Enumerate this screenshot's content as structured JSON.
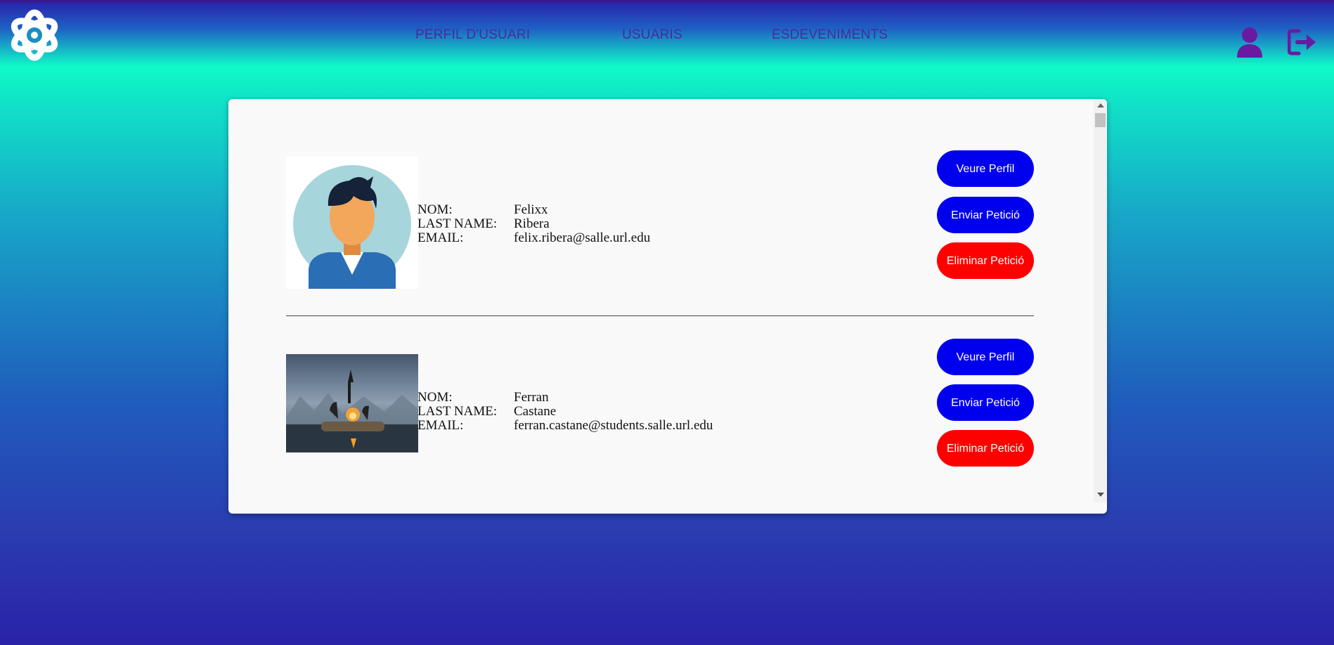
{
  "nav": {
    "profile": "PERFIL D'USUARI",
    "users": "USUARIS",
    "events": "ESDEVENIMENTS"
  },
  "icons": {
    "logo": "atom-gear-logo",
    "user": "user-icon",
    "logout": "logout-icon"
  },
  "colors": {
    "nav_text": "#4b2a9a",
    "primary_button": "#0000ee",
    "danger_button": "#ff0000"
  },
  "labels": {
    "name": "NOM:",
    "last_name": "LAST NAME:",
    "email": "EMAIL:"
  },
  "users": [
    {
      "name": "Felixx",
      "last_name": "Ribera",
      "email": "felix.ribera@salle.url.edu",
      "buttons": {
        "view": "Veure Perfil",
        "send": "Enviar Petició",
        "delete": "Eliminar Petició"
      }
    },
    {
      "name": "Ferran",
      "last_name": "Castane",
      "email": "ferran.castane@students.salle.url.edu",
      "buttons": {
        "view": "Veure Perfil",
        "send": "Enviar Petició",
        "delete": "Eliminar Petició"
      }
    }
  ]
}
